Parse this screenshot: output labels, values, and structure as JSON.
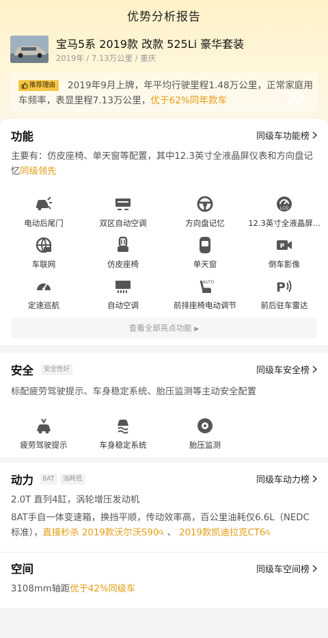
{
  "header": {
    "title": "优势分析报告"
  },
  "car": {
    "name": "宝马5系 2019款 改款 525Li 豪华套装",
    "meta": "2019年 / 7.13万公里 / 重庆"
  },
  "reason": {
    "badge": "推荐理由",
    "text": "2019年9月上牌，年平均行驶里程1.48万公里，正常家庭用车频率，表显里程7.13万公里，",
    "highlight": "优于62%同年款车"
  },
  "features": {
    "title": "功能",
    "link": "同级车功能榜",
    "desc": "主要有：仿皮座椅、单天窗等配置，其中12.3英寸全液晶屏仪表和方向盘记忆",
    "desc_highlight": "同级领先",
    "items": [
      {
        "label": "电动后尾门",
        "icon": "power-tailgate-icon"
      },
      {
        "label": "双区自动空调",
        "icon": "dual-zone-ac-icon"
      },
      {
        "label": "方向盘记忆",
        "icon": "steering-wheel-icon"
      },
      {
        "label": "12.3英寸全液晶屏...",
        "icon": "lcd-dashboard-icon"
      },
      {
        "label": "车联网",
        "icon": "connected-car-icon"
      },
      {
        "label": "仿皮座椅",
        "icon": "leather-seat-icon"
      },
      {
        "label": "单天窗",
        "icon": "sunroof-icon"
      },
      {
        "label": "倒车影像",
        "icon": "reverse-camera-icon"
      },
      {
        "label": "定速巡航",
        "icon": "cruise-control-icon"
      },
      {
        "label": "自动空调",
        "icon": "auto-ac-icon"
      },
      {
        "label": "前排座椅电动调节",
        "icon": "power-seat-icon"
      },
      {
        "label": "前后驻车雷达",
        "icon": "parking-radar-icon"
      }
    ],
    "view_all": "查看全部亮点功能"
  },
  "safety": {
    "title": "安全",
    "tag": "安全性好",
    "link": "同级车安全榜",
    "desc": "标配疲劳驾驶提示、车身稳定系统、胎压监测等主动安全配置",
    "items": [
      {
        "label": "疲劳驾驶提示",
        "icon": "fatigue-alert-icon"
      },
      {
        "label": "车身稳定系统",
        "icon": "stability-control-icon"
      },
      {
        "label": "胎压监测",
        "icon": "tire-pressure-icon"
      }
    ]
  },
  "power": {
    "title": "动力",
    "tags": [
      "8AT",
      "油耗低"
    ],
    "link": "同级车动力榜",
    "engine": "2.0T 直列4缸，涡轮增压发动机",
    "trans_desc": "8AT手自一体变速箱，换挡平顺，传动效率高，百公里油耗仅6.6L（NEDC标准），",
    "rival_prefix": "直接秒杀",
    "rival1": "2019款沃尔沃S90",
    "separator": "、",
    "rival2": "2019款凯迪拉克CT6"
  },
  "space": {
    "title": "空间",
    "link": "同级车空间榜",
    "desc": "3108mm轴距",
    "highlight": "优于42%同级车"
  },
  "colors": {
    "accent": "#e49b12",
    "badge": "#f6c544"
  }
}
